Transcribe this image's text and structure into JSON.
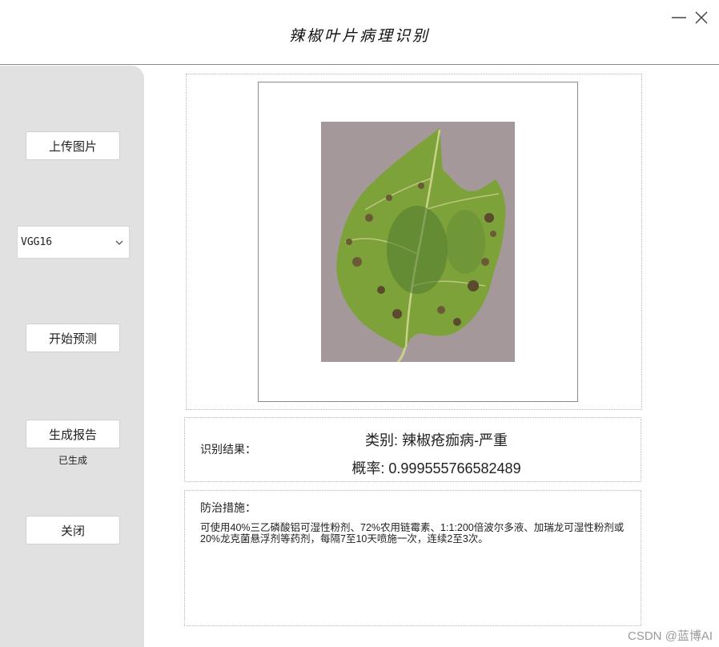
{
  "app": {
    "title": "辣椒叶片病理识别"
  },
  "window_controls": {
    "minimize_icon": "minimize-icon",
    "close_icon": "close-icon"
  },
  "sidebar": {
    "upload_label": "上传图片",
    "model_select": {
      "value": "VGG16"
    },
    "predict_label": "开始预测",
    "report_label": "生成报告",
    "report_status": "已生成",
    "close_label": "关闭"
  },
  "result": {
    "label": "识别结果：",
    "class_text": "类别: 辣椒疮痂病-严重",
    "probability_text": "概率: 0.999555766582489"
  },
  "measures": {
    "label": "防治措施：",
    "text": "可使用40%三乙磷酸铝可湿性粉剂、72%农用链霉素、1:1:200倍波尔多液、加瑞龙可湿性粉剂或20%龙克菌悬浮剂等药剂，每隔7至10天喷施一次，连续2至3次。"
  },
  "watermark": "CSDN @蓝博AI",
  "colors": {
    "sidebar_bg": "#e1e1e1",
    "leaf_green": "#6f9a2e",
    "photo_bg": "#a89a9c"
  }
}
